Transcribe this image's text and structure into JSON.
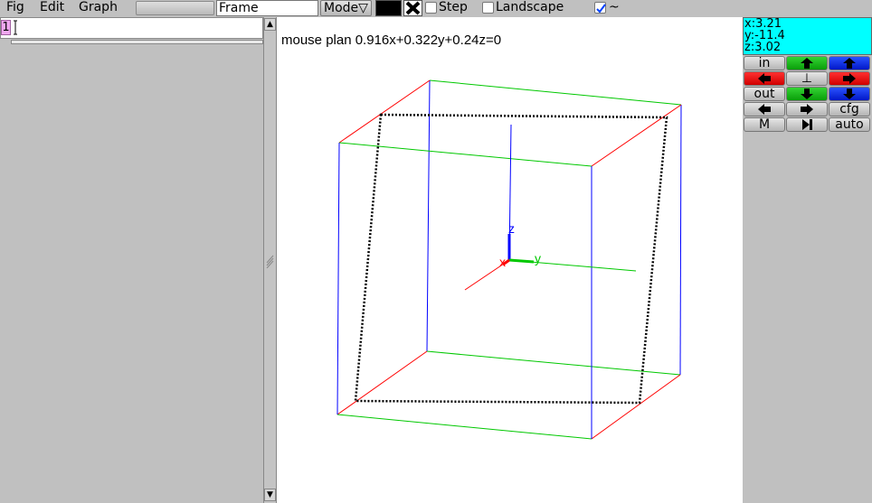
{
  "menu": {
    "fig": "Fig",
    "edit": "Edit",
    "graph": "Graph"
  },
  "toolbar": {
    "frame_value": "Frame",
    "mode_label": "Mode",
    "mode_arrow": "▽",
    "step_label": "Step",
    "step_checked": false,
    "landscape_label": "Landscape",
    "landscape_checked": false,
    "tilde_label": "~",
    "tilde_checked": true,
    "color": "#000000"
  },
  "editor": {
    "line_number": "1",
    "text": ""
  },
  "canvas": {
    "plan_text": "mouse plan 0.916x+0.322y+0.24z=0",
    "axis_labels": {
      "x": "x",
      "y": "y",
      "z": "z"
    },
    "colors": {
      "x_axis": "#ff0000",
      "y_axis": "#00c800",
      "z_axis": "#0000ff",
      "plane_outline": "#000000"
    }
  },
  "coords": {
    "x": "x:3.21",
    "y": "y:-11.4",
    "z": "z:3.02"
  },
  "controls": {
    "in": "in",
    "out": "out",
    "perp": "⊥",
    "cfg": "cfg",
    "m": "M",
    "auto": "auto",
    "icons": [
      "arrow-up-icon",
      "arrow-left-icon",
      "arrow-right-icon",
      "arrow-down-icon",
      "play-end-icon"
    ]
  }
}
